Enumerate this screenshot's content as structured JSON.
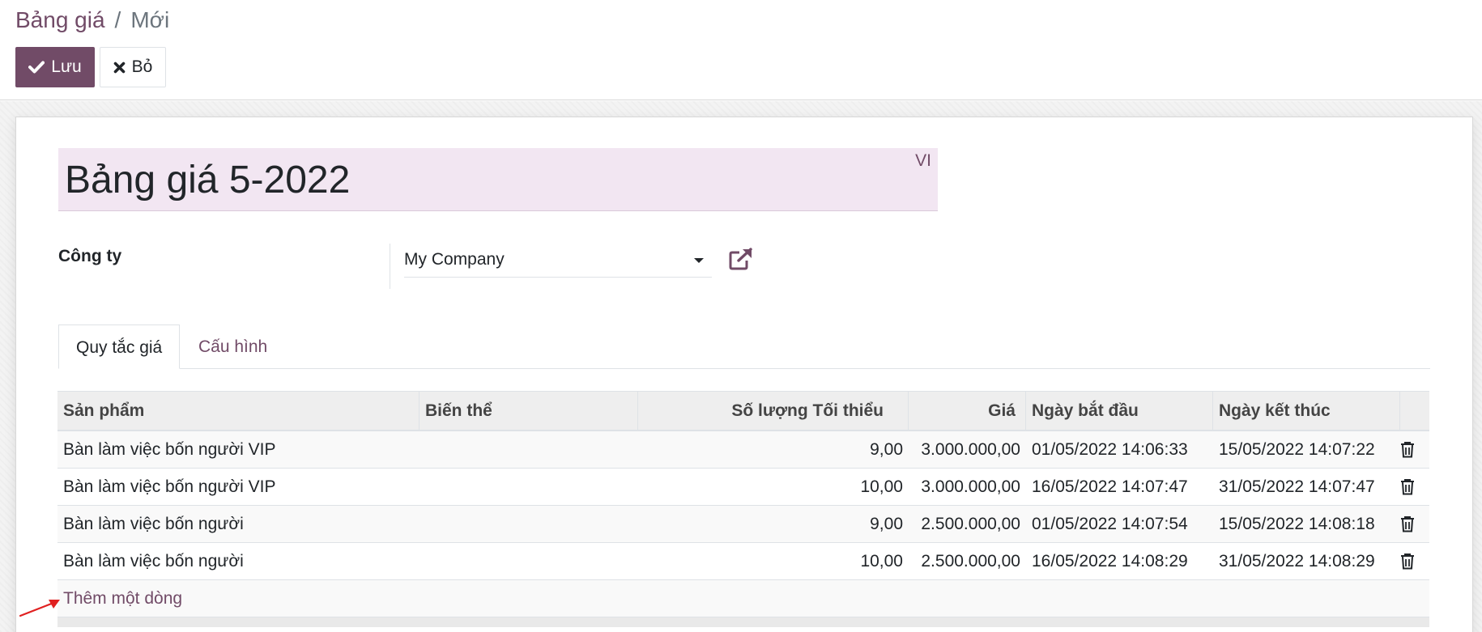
{
  "breadcrumb": {
    "parent": "Bảng giá",
    "separator": "/",
    "current": "Mới"
  },
  "toolbar": {
    "save_label": "Lưu",
    "discard_label": "Bỏ"
  },
  "form": {
    "title": "Bảng giá 5-2022",
    "lang": "VI",
    "company_label": "Công ty",
    "company_value": "My Company"
  },
  "tabs": [
    {
      "label": "Quy tắc giá",
      "active": true
    },
    {
      "label": "Cấu hình",
      "active": false
    }
  ],
  "table": {
    "headers": [
      "Sản phẩm",
      "Biến thể",
      "Số lượng Tối thiểu",
      "Giá",
      "Ngày bắt đầu",
      "Ngày kết thúc"
    ],
    "rows": [
      {
        "product": "Bàn làm việc bốn người VIP",
        "variant": "",
        "min_qty": "9,00",
        "price": "3.000.000,00",
        "start": "01/05/2022 14:06:33",
        "end": "15/05/2022 14:07:22"
      },
      {
        "product": "Bàn làm việc bốn người VIP",
        "variant": "",
        "min_qty": "10,00",
        "price": "3.000.000,00",
        "start": "16/05/2022 14:07:47",
        "end": "31/05/2022 14:07:47"
      },
      {
        "product": "Bàn làm việc bốn người",
        "variant": "",
        "min_qty": "9,00",
        "price": "2.500.000,00",
        "start": "01/05/2022 14:07:54",
        "end": "15/05/2022 14:08:18"
      },
      {
        "product": "Bàn làm việc bốn người",
        "variant": "",
        "min_qty": "10,00",
        "price": "2.500.000,00",
        "start": "16/05/2022 14:08:29",
        "end": "31/05/2022 14:08:29"
      }
    ],
    "add_line_label": "Thêm một dòng"
  },
  "colors": {
    "primary": "#714b67",
    "title_bg": "#f2e6f2",
    "annotation": "#e02020"
  },
  "icons": {
    "save": "check-icon",
    "discard": "times-icon",
    "external": "external-link-icon",
    "delete": "trash-icon",
    "dropdown": "caret-down-icon"
  }
}
